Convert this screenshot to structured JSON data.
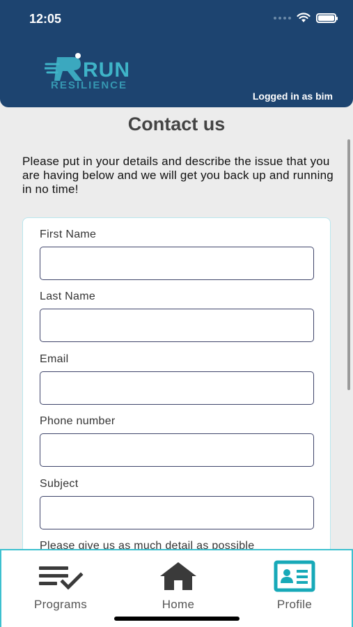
{
  "status_bar": {
    "time": "12:05"
  },
  "header": {
    "logo_primary": "RUN",
    "logo_secondary": "RESILIENCE",
    "logged_in": "Logged in as bim"
  },
  "page": {
    "title": "Contact us",
    "intro": "Please put in your details and describe the issue that you are having below and we will get you back up and running in no time!"
  },
  "form": {
    "fields": [
      {
        "label": "First Name",
        "value": ""
      },
      {
        "label": "Last Name",
        "value": ""
      },
      {
        "label": "Email",
        "value": ""
      },
      {
        "label": "Phone number",
        "value": ""
      },
      {
        "label": "Subject",
        "value": ""
      }
    ],
    "detail_label": "Please give us as much detail as possible"
  },
  "tabbar": {
    "tabs": [
      {
        "label": "Programs",
        "icon": "checklist-icon",
        "active": false
      },
      {
        "label": "Home",
        "icon": "home-icon",
        "active": false
      },
      {
        "label": "Profile",
        "icon": "id-card-icon",
        "active": true
      }
    ]
  },
  "colors": {
    "header_bg": "#1d4470",
    "accent": "#3cc0cf",
    "input_border": "#3d4369",
    "icon_dark": "#3a3a3a",
    "icon_active": "#17a9b8"
  }
}
